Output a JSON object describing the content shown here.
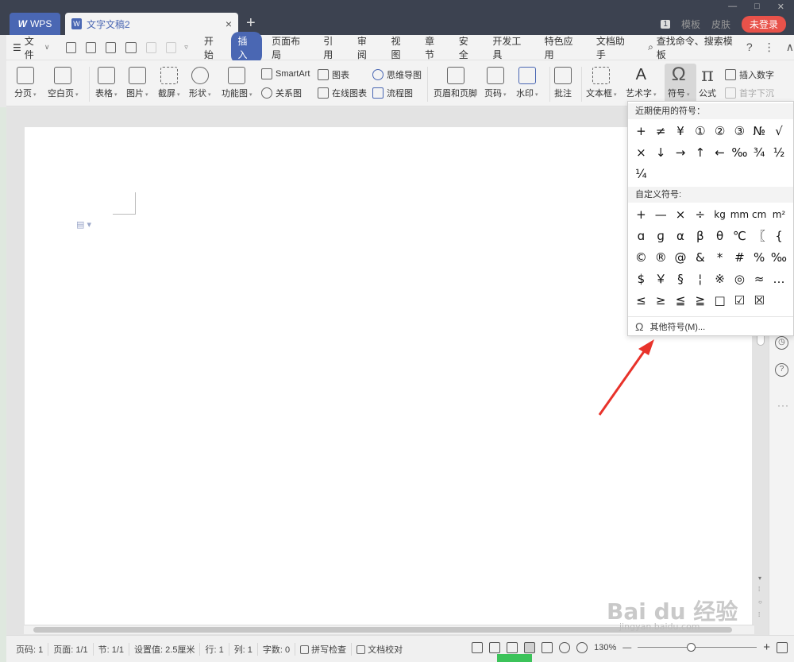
{
  "titlebar": {
    "app_tab": "WPS",
    "app_logo": "W",
    "doc_tab": "文字文稿2",
    "doc_icon": "W",
    "close": "×",
    "new_tab": "+",
    "badge": "1",
    "template": "模板",
    "skin": "皮肤",
    "login": "未登录",
    "minimize": "—",
    "maximize": "□",
    "window_close": "✕"
  },
  "menubar": {
    "file": "文件",
    "items": [
      "开始",
      "插入",
      "页面布局",
      "引用",
      "审阅",
      "视图",
      "章节",
      "安全",
      "开发工具",
      "特色应用",
      "文档助手"
    ],
    "active": "插入",
    "search": "查找命令、搜索模板",
    "help": "?",
    "more": "⋮",
    "collapse": "∧"
  },
  "ribbon": {
    "page_break": "分页",
    "blank_page": "空白页",
    "table": "表格",
    "picture": "图片",
    "screenshot": "截屏",
    "shape": "形状",
    "function_chart": "功能图",
    "smartart": "SmartArt",
    "chart": "图表",
    "relation_chart": "关系图",
    "online_chart": "在线图表",
    "mindmap": "思维导图",
    "flowchart": "流程图",
    "header_footer": "页眉和页脚",
    "page_number": "页码",
    "watermark": "水印",
    "comment": "批注",
    "textbox": "文本框",
    "wordart": "艺术字",
    "symbol": "符号",
    "formula": "公式",
    "insert_number": "插入数字",
    "drop_cap": "首字下沉"
  },
  "symbol_dropdown": {
    "recent_header": "近期使用的符号：",
    "recent": [
      "+",
      "≠",
      "¥",
      "①",
      "②",
      "③",
      "№",
      "√",
      "×",
      "↓",
      "→",
      "↑",
      "←",
      "‰",
      "¾",
      "½",
      "¼"
    ],
    "custom_header": "自定义符号:",
    "custom": [
      "+",
      "—",
      "×",
      "÷",
      "kg",
      "mm",
      "cm",
      "m²",
      "ɑ",
      "ɡ",
      "α",
      "β",
      "θ",
      "℃",
      "〖",
      "{",
      "©",
      "®",
      "@",
      "&",
      "*",
      "#",
      "%",
      "‰",
      "$",
      "￥",
      "§",
      "¦",
      "※",
      "◎",
      "≈",
      "…",
      "≤",
      "≥",
      "≦",
      "≧",
      "□",
      "☑",
      "☒"
    ],
    "more": "其他符号(M)..."
  },
  "statusbar": {
    "page_num": "页码: 1",
    "pages": "页面: 1/1",
    "section": "节: 1/1",
    "setting": "设置值: 2.5厘米",
    "row": "行: 1",
    "col": "列: 1",
    "words": "字数: 0",
    "spellcheck": "拼写检查",
    "doc_check": "文档校对",
    "zoom": "130%",
    "zoom_out": "—",
    "zoom_in": "+"
  },
  "watermark": {
    "text": "Bai  du 经验",
    "sub": "jingyan.baidu.com"
  },
  "colors": {
    "accent": "#4a67b3",
    "titlebar": "#3c4250",
    "login": "#e8524a",
    "arrow": "#e8322a"
  }
}
